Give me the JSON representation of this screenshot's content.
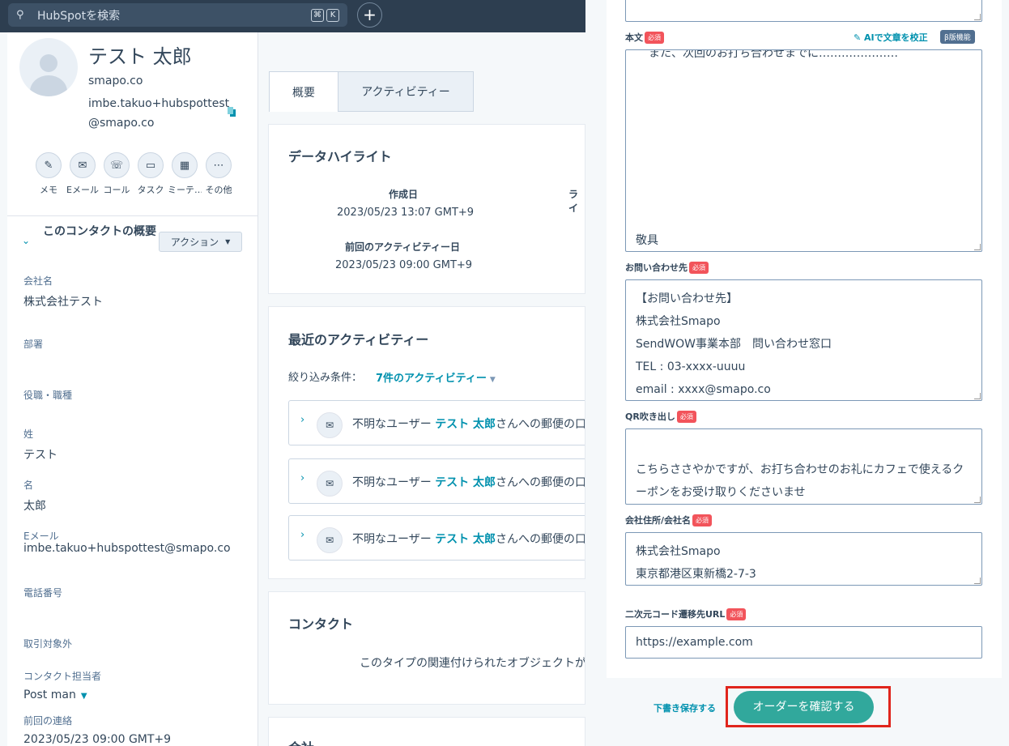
{
  "topbar": {
    "search_placeholder": "HubSpotを検索",
    "shortcut_cmd": "⌘",
    "shortcut_key": "K",
    "plus": "+"
  },
  "contact": {
    "name": "テスト 太郎",
    "domain": "smapo.co",
    "email_line1": "imbe.takuo+hubspottest",
    "email_line2": "@smapo.co",
    "actions": [
      {
        "label": "メモ",
        "icon": "✎"
      },
      {
        "label": "Eメール",
        "icon": "✉"
      },
      {
        "label": "コール",
        "icon": "☏"
      },
      {
        "label": "タスク",
        "icon": "▭"
      },
      {
        "label": "ミーテ…",
        "icon": "▦"
      },
      {
        "label": "その他",
        "icon": "⋯"
      }
    ],
    "summary_title": "このコンタクトの概要",
    "action_button": "アクション",
    "props": {
      "company_label": "会社名",
      "company_value": "株式会社テスト",
      "dept_label": "部署",
      "title_label": "役職・職種",
      "last_label": "姓",
      "last_value": "テスト",
      "first_label": "名",
      "first_value": "太郎",
      "email_label": "Eメール",
      "email_value": "imbe.takuo+hubspottest@smapo.co",
      "phone_label": "電話番号",
      "excluded_label": "取引対象外",
      "owner_label": "コンタクト担当者",
      "owner_value": "Post man",
      "lastcontact_label": "前回の連絡",
      "lastcontact_value": "2023/05/23 09:00 GMT+9"
    }
  },
  "tabs": {
    "overview": "概要",
    "activity": "アクティビティー"
  },
  "highlights": {
    "title": "データハイライト",
    "created_label": "作成日",
    "created_value": "2023/05/23 13:07 GMT+9",
    "life_label": "ライ",
    "lastact_label": "前回のアクティビティー日",
    "lastact_value": "2023/05/23 09:00 GMT+9"
  },
  "recent": {
    "title": "最近のアクティビティー",
    "filter_label": "絞り込み条件：",
    "filter_link": "7件のアクティビティー",
    "item_prefix": "不明なユーザー",
    "item_name": "テスト 太郎",
    "item_suffix": "さんへの郵便の口"
  },
  "contacts_card": {
    "title": "コンタクト",
    "empty": "このタイプの関連付けられたオブジェクトが"
  },
  "company_card": {
    "title": "会社"
  },
  "form": {
    "body_label": "本文",
    "required": "必須",
    "ai_link": "AIで文章を校正",
    "beta": "β版機能",
    "body_line_top": "また、次回のお打ち合わせまでに…………………",
    "body_line_bottom": "敬具",
    "inquiry_label": "お問い合わせ先",
    "inquiry_lines": [
      "【お問い合わせ先】",
      "株式会社Smapo",
      "SendWOW事業本部　問い合わせ窓口",
      "TEL : 03-xxxx-uuuu",
      "email : xxxx@smapo.co"
    ],
    "qr_label": "QR吹き出し",
    "qr_lines": [
      "こちらささやかですが、お打ち合わせのお礼にカフェで使えるク",
      "ーポンをお受け取りくださいませ"
    ],
    "address_label": "会社住所/会社名",
    "address_lines": [
      "株式会社Smapo",
      "東京都港区東新橋2-7-3"
    ],
    "url_label": "二次元コード遷移先URL",
    "url_value": "https://example.com",
    "draft": "下書き保存する",
    "confirm": "オーダーを確認する"
  }
}
